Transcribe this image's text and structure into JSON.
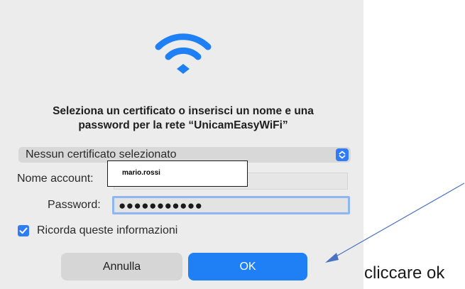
{
  "dialog": {
    "prompt_line1": "Seleziona un certificato o inserisci un nome e una",
    "prompt_line2": "password per la rete “UnicamEasyWiFi”",
    "certificate_select": "Nessun certificato selezionato",
    "account_label": "Nome account:",
    "account_value": "mario.rossi",
    "password_label": "Password:",
    "password_value": "●●●●●●●●●●●",
    "remember_label": "Ricorda queste informazioni",
    "remember_checked": true,
    "cancel_label": "Annulla",
    "ok_label": "OK"
  },
  "annotation": {
    "text": "cliccare ok"
  },
  "colors": {
    "accent": "#1f7ff5",
    "dialog_bg": "#ececec",
    "arrow": "#4a72c4"
  },
  "icons": [
    "wifi-icon",
    "chevron-up-down-icon",
    "checkmark-icon",
    "arrow-annotation"
  ]
}
